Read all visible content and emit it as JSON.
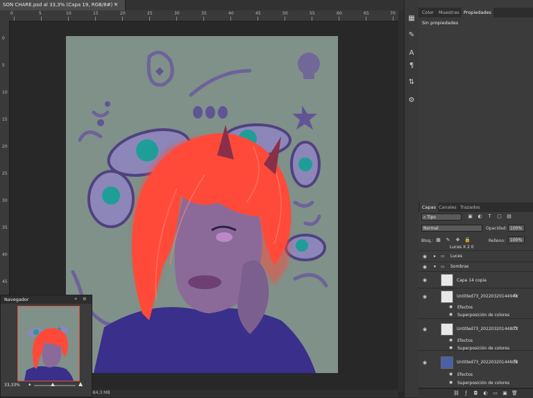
{
  "document": {
    "tab_title": "SON CHARE.psd al 33,3% (Capa 19, RGB/8#) *",
    "close_glyph": "×"
  },
  "rulers": {
    "top_labels": [
      "0",
      "5",
      "10",
      "15",
      "20",
      "25",
      "30",
      "35",
      "40",
      "45",
      "50",
      "55",
      "60",
      "65",
      "70"
    ],
    "left_labels": [
      "0",
      "5",
      "10",
      "15",
      "20",
      "25",
      "30",
      "35",
      "40",
      "45",
      "50"
    ]
  },
  "status": {
    "zoom": "33,33%",
    "doc_size": "Doc: 22,9 MB/384,3 MB"
  },
  "properties_panel": {
    "tabs": [
      "Color",
      "Muestras",
      "Propiedades"
    ],
    "active_tab": "Propiedades",
    "content": "Sin propiedades"
  },
  "layers_panel": {
    "tabs": [
      "Capas",
      "Canales",
      "Trazados"
    ],
    "active_tab": "Capas",
    "filter_kind": "Tipo",
    "blend_mode": "Normal",
    "opacity_label": "Opacidad:",
    "opacity_value": "100%",
    "lock_label": "Bloq.:",
    "fill_label": "Relleno:",
    "fill_value": "100%",
    "layers": [
      {
        "name": "Luces X 2 0",
        "type": "group"
      },
      {
        "name": "Luces",
        "type": "group"
      },
      {
        "name": "Sombras",
        "type": "group",
        "expanded": true
      },
      {
        "name": "Capa 14 copia",
        "type": "layer"
      },
      {
        "name": "Untitled73_20220320144944",
        "type": "layer",
        "fx": true,
        "effects_label": "Efectos",
        "effect": "Superposición de colores"
      },
      {
        "name": "Untitled73_20220320144807",
        "type": "layer",
        "fx": true,
        "effects_label": "Efectos",
        "effect": "Superposición de colores"
      },
      {
        "name": "Untitled73_20220320144609",
        "type": "layer",
        "fx": true,
        "effects_label": "Efectos",
        "effect": "Superposición de colores"
      }
    ],
    "fx_glyph": "fx"
  },
  "navigator": {
    "title": "Navegador",
    "zoom": "33,33%"
  },
  "colors": {
    "accent_red": "#e24a3b",
    "artwork_bg": "#7f9189",
    "hair": "#ff4a3a",
    "shirt": "#3a2f8a"
  }
}
